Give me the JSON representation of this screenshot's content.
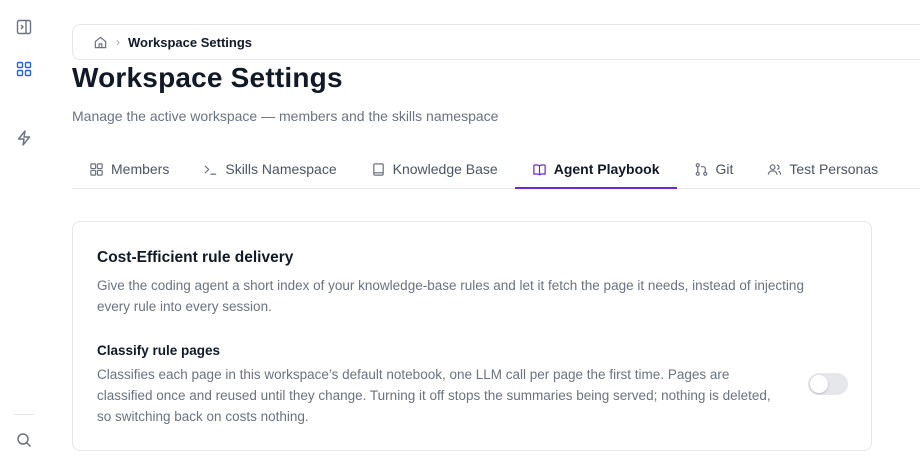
{
  "rail": {
    "icons": [
      "sidebar-expand-icon",
      "grid-icon",
      "lightning-icon",
      "search-icon"
    ]
  },
  "breadcrumb": {
    "home_icon": "home-icon",
    "separator": "›",
    "current": "Workspace Settings"
  },
  "page": {
    "title": "Workspace Settings",
    "subtitle": "Manage the active workspace — members and the skills namespace"
  },
  "tabs": [
    {
      "label": "Members",
      "icon": "grid-icon",
      "active": false
    },
    {
      "label": "Skills Namespace",
      "icon": "terminal-icon",
      "active": false
    },
    {
      "label": "Knowledge Base",
      "icon": "book-icon",
      "active": false
    },
    {
      "label": "Agent Playbook",
      "icon": "book-open-icon",
      "active": true
    },
    {
      "label": "Git",
      "icon": "git-icon",
      "active": false
    },
    {
      "label": "Test Personas",
      "icon": "users-icon",
      "active": false
    }
  ],
  "card": {
    "title": "Cost-Efficient rule delivery",
    "description": "Give the coding agent a short index of your knowledge-base rules and let it fetch the page it needs, instead of injecting every rule into every session.",
    "option": {
      "title": "Classify rule pages",
      "description": "Classifies each page in this workspace’s default notebook, one LLM call per page the first time. Pages are classified once and reused until they change. Turning it off stops the summaries being served; nothing is deleted, so switching back on costs nothing.",
      "enabled": false
    }
  },
  "colors": {
    "accent": "#6d28d9",
    "rail_icon": "#6b7280",
    "rail_icon_active": "#2563eb"
  }
}
